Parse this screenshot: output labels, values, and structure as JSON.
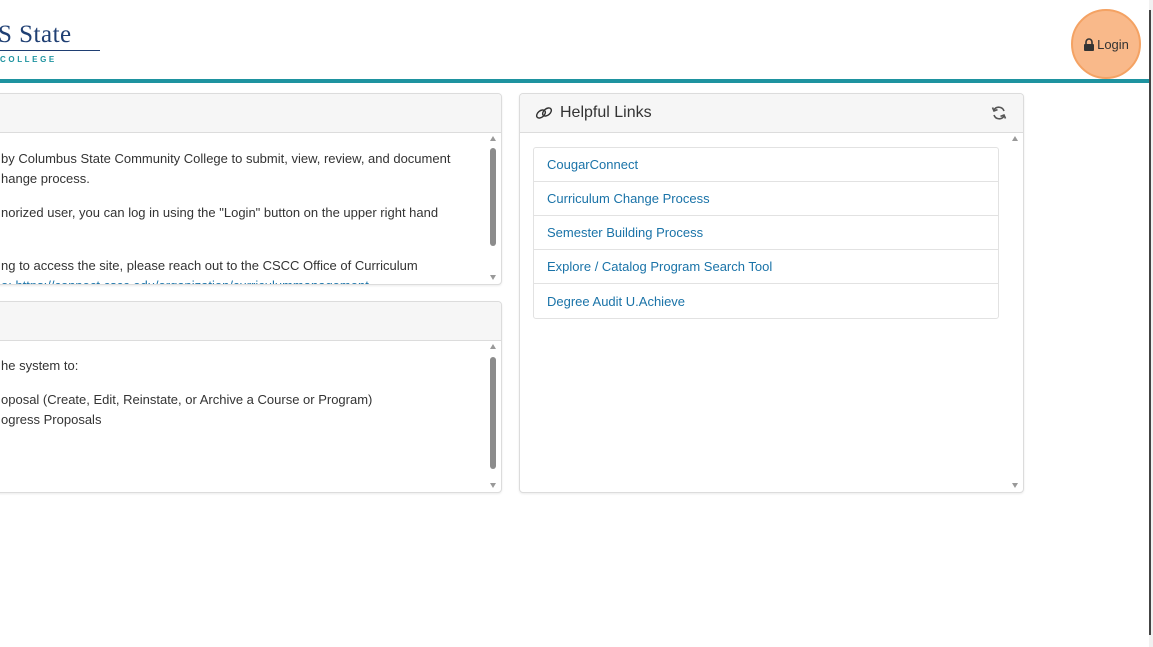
{
  "header": {
    "logo_main": "S State",
    "logo_sub": "COLLEGE",
    "login_label": "Login",
    "accent_color": "#1e93a0",
    "brand_color": "#1f3f73",
    "login_bg": "#f9b98a"
  },
  "panel1": {
    "lines": [
      "by Columbus State Community College to submit, view, review, and document",
      "hange process.",
      "norized user, you can log in using the \"Login\" button on the upper right hand",
      "ng to access the site, please reach out to the CSCC Office of Curriculum",
      "o: https://connect.cscc.edu/organization/curriculummanagement"
    ]
  },
  "panel2": {
    "lines": [
      "he system to:",
      "oposal (Create, Edit, Reinstate, or Archive a Course or Program)",
      "ogress Proposals"
    ]
  },
  "helpful_links": {
    "title": "Helpful Links",
    "link_icon": "link-icon",
    "refresh_icon": "refresh-icon",
    "items": [
      {
        "label": "CougarConnect"
      },
      {
        "label": "Curriculum Change Process"
      },
      {
        "label": "Semester Building Process"
      },
      {
        "label": "Explore / Catalog Program Search Tool"
      },
      {
        "label": "Degree Audit U.Achieve"
      }
    ],
    "link_color": "#1a73a8"
  }
}
